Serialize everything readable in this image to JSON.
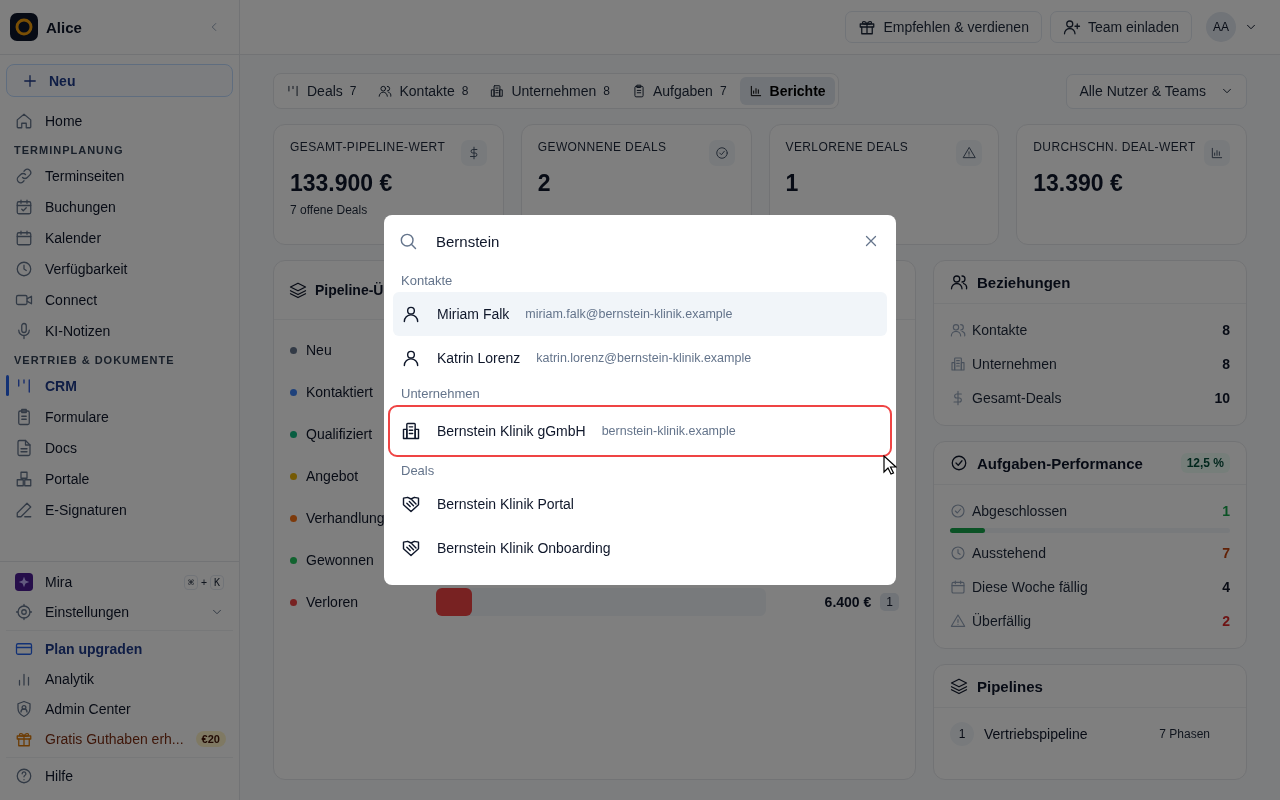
{
  "sidebar": {
    "workspace": "Alice",
    "new_button": "Neu",
    "nav": [
      {
        "kind": "item",
        "label": "Home",
        "selected": false
      },
      {
        "kind": "heading",
        "label": "TERMINPLANUNG"
      },
      {
        "kind": "item",
        "label": "Terminseiten",
        "selected": false
      },
      {
        "kind": "item",
        "label": "Buchungen",
        "selected": false
      },
      {
        "kind": "item",
        "label": "Kalender",
        "selected": false
      },
      {
        "kind": "item",
        "label": "Verfügbarkeit",
        "selected": false
      },
      {
        "kind": "item",
        "label": "Connect",
        "selected": false
      },
      {
        "kind": "item",
        "label": "KI-Notizen",
        "selected": false
      },
      {
        "kind": "heading",
        "label": "VERTRIEB & DOKUMENTE"
      },
      {
        "kind": "item",
        "label": "CRM",
        "selected": true
      },
      {
        "kind": "item",
        "label": "Formulare",
        "selected": false
      },
      {
        "kind": "item",
        "label": "Docs",
        "selected": false
      },
      {
        "kind": "item",
        "label": "Portale",
        "selected": false
      },
      {
        "kind": "item",
        "label": "E-Signaturen",
        "selected": false
      }
    ],
    "bottom_groups": [
      {
        "items": [
          {
            "kind": "assistant",
            "label": "Mira",
            "keys": [
              "⌘",
              "+",
              "K"
            ]
          },
          {
            "kind": "expandable",
            "label": "Einstellungen",
            "expanded": false
          }
        ]
      },
      {
        "items": [
          {
            "kind": "upgrade",
            "label": "Plan upgraden"
          },
          {
            "kind": "item",
            "label": "Analytik"
          },
          {
            "kind": "item",
            "label": "Admin Center"
          },
          {
            "kind": "promo",
            "label": "Gratis Guthaben erh...",
            "badge": "€20"
          }
        ]
      },
      {
        "items": [
          {
            "kind": "item",
            "label": "Hilfe"
          }
        ]
      }
    ]
  },
  "topbar": {
    "actions": [
      "Empfehlen & verdienen",
      "Team einladen"
    ],
    "avatar": "AA"
  },
  "tabs": [
    {
      "label": "Deals",
      "count": "7",
      "selected": false
    },
    {
      "label": "Kontakte",
      "count": "8",
      "selected": false
    },
    {
      "label": "Unternehmen",
      "count": "8",
      "selected": false
    },
    {
      "label": "Aufgaben",
      "count": "7",
      "selected": false
    },
    {
      "label": "Berichte",
      "selected": true
    }
  ],
  "filter": "Alle Nutzer & Teams",
  "stats": [
    {
      "label": "GESAMT-PIPELINE-WERT",
      "value": "133.900 €",
      "note": "7 offene Deals"
    },
    {
      "label": "GEWONNENE DEALS",
      "value": "2"
    },
    {
      "label": "VERLORENE DEALS",
      "value": "1"
    },
    {
      "label": "DURCHSCHN. DEAL-WERT",
      "value": "13.390 €"
    }
  ],
  "pipeline": {
    "title": "Pipeline-Ü",
    "stages": [
      {
        "name": "Neu",
        "color": "#323a46"
      },
      {
        "name": "Kontaktiert",
        "color": "#1e417b"
      },
      {
        "name": "Qualifiziert",
        "color": "#085d41"
      },
      {
        "name": "Angebot",
        "color": "#755a04"
      },
      {
        "name": "Verhandlung",
        "color": "#7d3a0b"
      },
      {
        "name": "Gewonnen",
        "color": "#11632f"
      },
      {
        "name": "Verloren",
        "color": "#782222",
        "level": 0.11,
        "amount": "6.400 €",
        "count": "1"
      }
    ]
  },
  "relations": {
    "title": "Beziehungen",
    "rows": [
      {
        "label": "Kontakte",
        "value": "8"
      },
      {
        "label": "Unternehmen",
        "value": "8"
      },
      {
        "label": "Gesamt-Deals",
        "value": "10"
      }
    ]
  },
  "tasks": {
    "title": "Aufgaben-Performance",
    "badge": "12,5 %",
    "rows": [
      {
        "label": "Abgeschlossen",
        "value": "1",
        "color": "#0b5225",
        "level": 0.125
      },
      {
        "label": "Ausstehend",
        "value": "7",
        "color": "#612106"
      },
      {
        "label": "Diese Woche fällig",
        "value": "4",
        "color": "#090c14"
      },
      {
        "label": "Überfällig",
        "value": "2",
        "color": "#6e1313"
      }
    ]
  },
  "pipelines": {
    "title": "Pipelines",
    "rows": [
      {
        "index": "1",
        "name": "Vertriebspipeline",
        "phases": "7 Phasen"
      }
    ]
  },
  "search": {
    "query": "Bernstein",
    "groups": [
      {
        "title": "Kontakte",
        "kind": "contact",
        "results": [
          {
            "name": "Miriam Falk",
            "detail": "miriam.falk@bernstein-klinik.example",
            "selected": true,
            "outlined": false
          },
          {
            "name": "Katrin Lorenz",
            "detail": "katrin.lorenz@bernstein-klinik.example",
            "selected": false,
            "outlined": false
          }
        ]
      },
      {
        "title": "Unternehmen",
        "kind": "company",
        "results": [
          {
            "name": "Bernstein Klinik gGmbH",
            "detail": "bernstein-klinik.example",
            "selected": false,
            "outlined": true
          }
        ]
      },
      {
        "title": "Deals",
        "kind": "deal",
        "results": [
          {
            "name": "Bernstein Klinik Portal",
            "selected": false,
            "outlined": false
          },
          {
            "name": "Bernstein Klinik Onboarding",
            "selected": false,
            "outlined": false
          }
        ]
      }
    ]
  }
}
